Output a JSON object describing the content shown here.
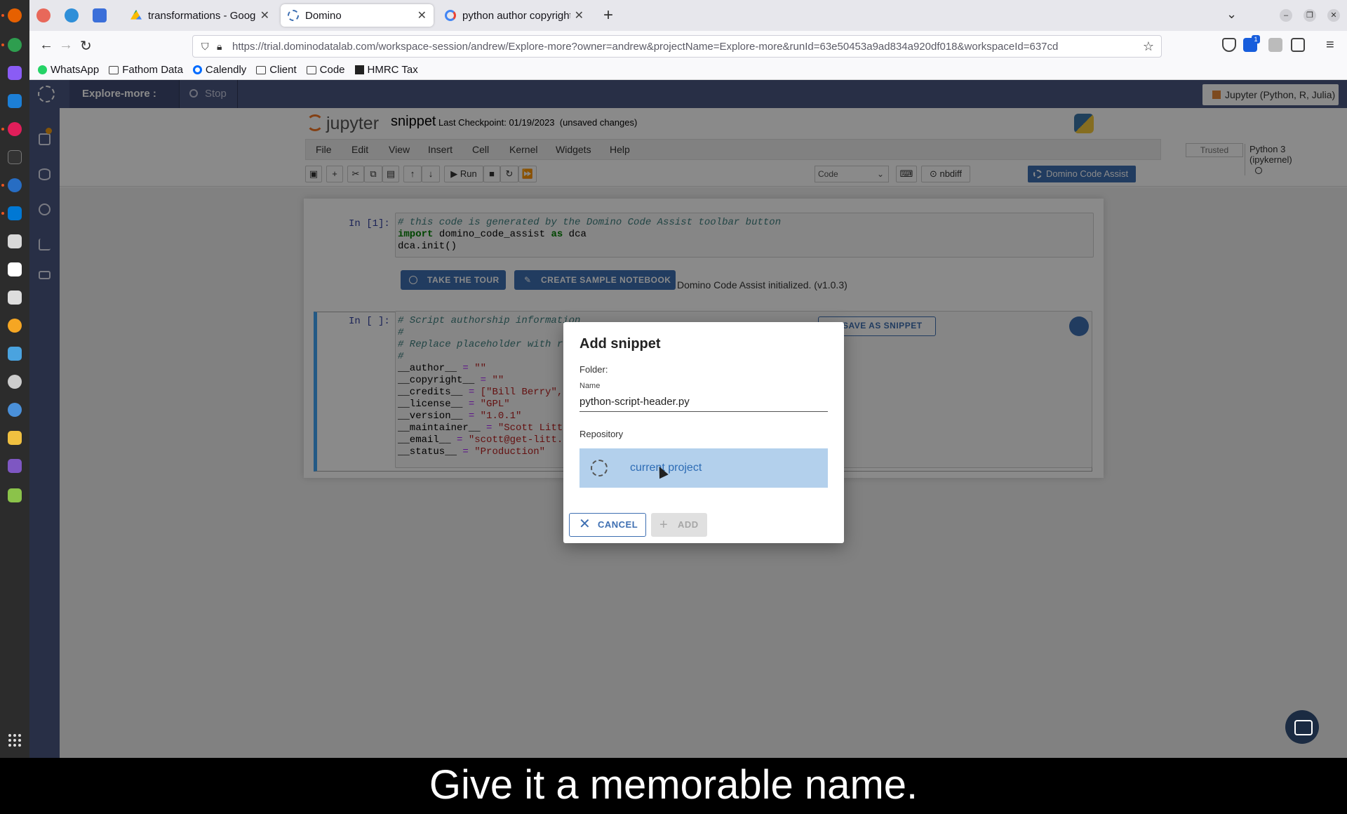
{
  "browser": {
    "tabs": [
      {
        "title": "transformations - Google",
        "active": false
      },
      {
        "title": "Domino",
        "active": true
      },
      {
        "title": "python author copyright",
        "active": false
      }
    ],
    "url": "https://trial.dominodatalab.com/workspace-session/andrew/Explore-more?owner=andrew&projectName=Explore-more&runId=63e50453a9ad834a920df018&workspaceId=637cd",
    "extension_badge": "1",
    "bookmarks": [
      "WhatsApp",
      "Fathom Data",
      "Calendly",
      "Client",
      "Code",
      "HMRC Tax"
    ]
  },
  "domino": {
    "workspace_title": "Explore-more : Jupyter",
    "stop_label": "Stop",
    "environment_label": "Jupyter (Python, R, Julia)"
  },
  "jupyter": {
    "logo_text": "jupyter",
    "notebook_name": "snippet",
    "checkpoint": "Last Checkpoint: 01/19/2023",
    "unsaved": "(unsaved changes)",
    "menus": [
      "File",
      "Edit",
      "View",
      "Insert",
      "Cell",
      "Kernel",
      "Widgets",
      "Help"
    ],
    "trusted": "Trusted",
    "kernel": "Python 3 (ipykernel)",
    "toolbar": {
      "run_label": "Run",
      "cell_type": "Code",
      "nbdiff_label": "nbdiff",
      "dca_label": "Domino Code Assist"
    },
    "cell1": {
      "prompt": "In [1]:",
      "line1": "# this code is generated by the Domino Code Assist toolbar button",
      "line2_kw": "import",
      "line2_rest": " domino_code_assist ",
      "line2_as": "as",
      "line2_end": " dca",
      "line3": "dca.init()",
      "take_tour": "TAKE THE TOUR",
      "create_sample": "CREATE SAMPLE NOTEBOOK",
      "status": "Domino Code Assist initialized. (v1.0.3)"
    },
    "cell2": {
      "prompt": "In [ ]:",
      "lines": [
        "# Script authorship information",
        "#",
        "# Replace placeholder with re",
        "#"
      ],
      "assignments": [
        {
          "var": "__author__",
          "val": "\"\""
        },
        {
          "var": "__copyright__",
          "val": "\"\""
        },
        {
          "var": "__credits__",
          "val": "[\"Bill Berry\","
        },
        {
          "var": "__license__",
          "val": "\"GPL\""
        },
        {
          "var": "__version__",
          "val": "\"1.0.1\""
        },
        {
          "var": "__maintainer__",
          "val": "\"Scott Litt"
        },
        {
          "var": "__email__",
          "val": "\"scott@get-litt.c"
        },
        {
          "var": "__status__",
          "val": "\"Production\""
        }
      ],
      "save_snippet": "SAVE AS SNIPPET"
    }
  },
  "modal": {
    "title": "Add snippet",
    "folder_label": "Folder:",
    "name_label": "Name",
    "name_value": "python-script-header.py",
    "repository_label": "Repository",
    "repository_option": "current project",
    "cancel_label": "CANCEL",
    "add_label": "ADD"
  },
  "caption": "Give it a memorable name.",
  "colors": {
    "domino_header": "#4b5782",
    "primary_blue": "#3e6fb2",
    "selected_repo": "#b3d0ec",
    "caption_bg": "#000000"
  }
}
